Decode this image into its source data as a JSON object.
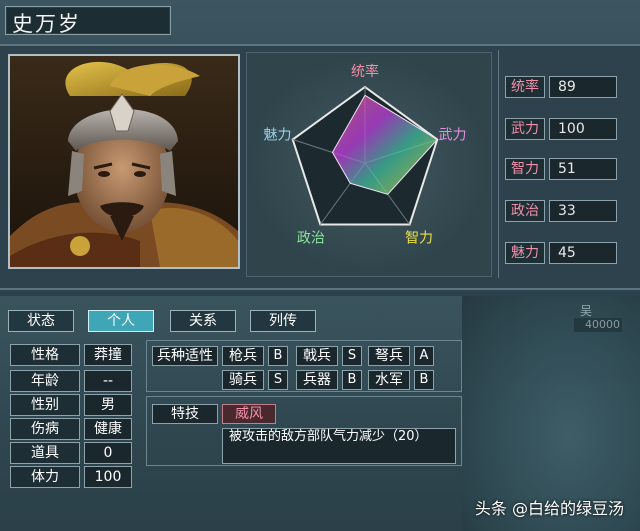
{
  "character": {
    "name": "史万岁"
  },
  "radar": {
    "axes": [
      "统率",
      "武力",
      "智力",
      "政治",
      "魅力"
    ],
    "values": [
      89,
      100,
      51,
      33,
      45
    ],
    "max": 100
  },
  "stats": [
    {
      "label": "统率",
      "value": "89"
    },
    {
      "label": "武力",
      "value": "100"
    },
    {
      "label": "智力",
      "value": "51"
    },
    {
      "label": "政治",
      "value": "33"
    },
    {
      "label": "魅力",
      "value": "45"
    }
  ],
  "tabs": [
    "状态",
    "个人",
    "关系",
    "列传"
  ],
  "active_tab": "个人",
  "personal": [
    {
      "label": "性格",
      "value": "莽撞"
    },
    {
      "label": "年龄",
      "value": "--"
    },
    {
      "label": "性别",
      "value": "男"
    },
    {
      "label": "伤病",
      "value": "健康"
    },
    {
      "label": "道具",
      "value": "0"
    },
    {
      "label": "体力",
      "value": "100"
    }
  ],
  "troop_aptitude": {
    "label": "兵种适性",
    "items": [
      {
        "name": "枪兵",
        "grade": "B"
      },
      {
        "name": "戟兵",
        "grade": "S"
      },
      {
        "name": "弩兵",
        "grade": "A"
      },
      {
        "name": "骑兵",
        "grade": "S"
      },
      {
        "name": "兵器",
        "grade": "B"
      },
      {
        "name": "水军",
        "grade": "B"
      }
    ]
  },
  "skill": {
    "label": "特技",
    "name": "威风",
    "description": "被攻击的敌方部队气力减少（20）"
  },
  "map_overlay": {
    "city": "吴",
    "troops": "40000"
  },
  "watermark": "头条 @白给的绿豆汤",
  "colors": {
    "stat_label": "#f08fa8",
    "active_tab": "#3fa6b8",
    "skill_name": "#f08fa8"
  }
}
